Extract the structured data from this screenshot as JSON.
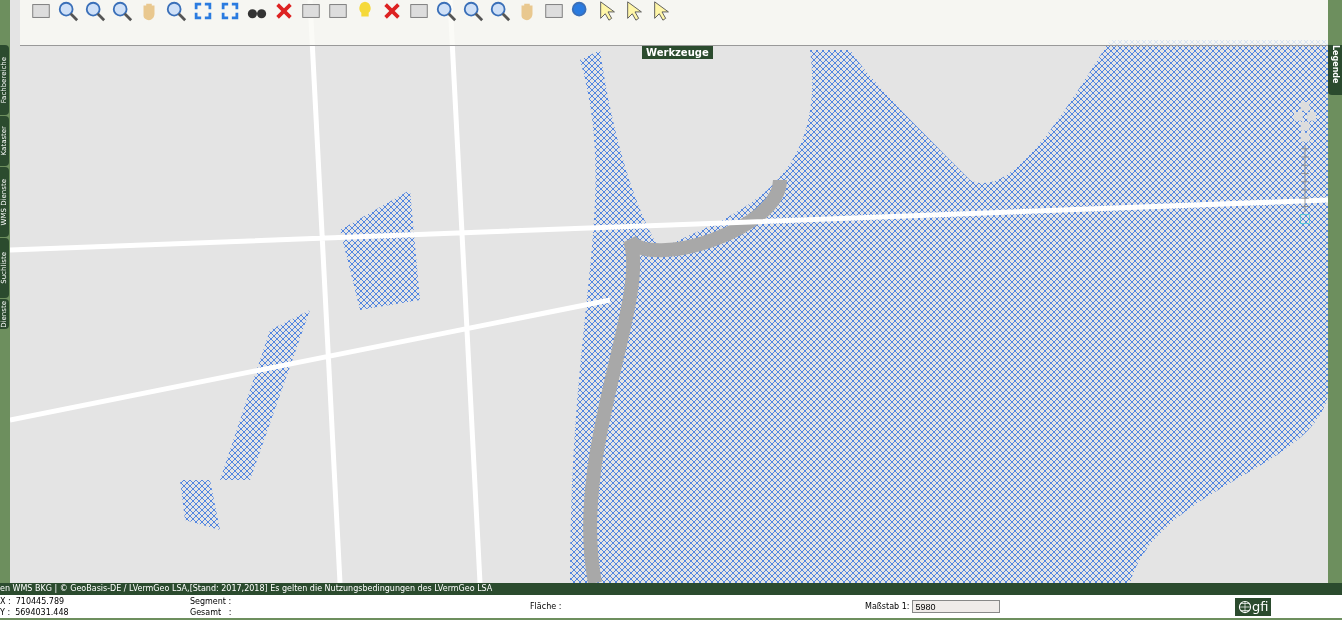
{
  "side_tabs": [
    "Fachbereiche",
    "Kataster",
    "WMS Dienste",
    "Suchliste",
    "Dienste"
  ],
  "tools_tab": "Werkzeuge",
  "legend_tab": "Legende",
  "attribution": "en WMS BKG | © GeoBasis-DE / LVermGeo LSA,[Stand: 2017,2018] Es gelten die Nutzungsbedingungen des LVermGeo LSA",
  "status": {
    "x_label": "X :",
    "x_value": "710445.789",
    "y_label": "Y :",
    "y_value": "5694031.448",
    "segment": "Segment :",
    "gesamt": "Gesamt   :",
    "flaeche": "Fläche :",
    "scale_label": "Maßstab 1:",
    "scale_value": "5980",
    "logo": "gfi"
  }
}
